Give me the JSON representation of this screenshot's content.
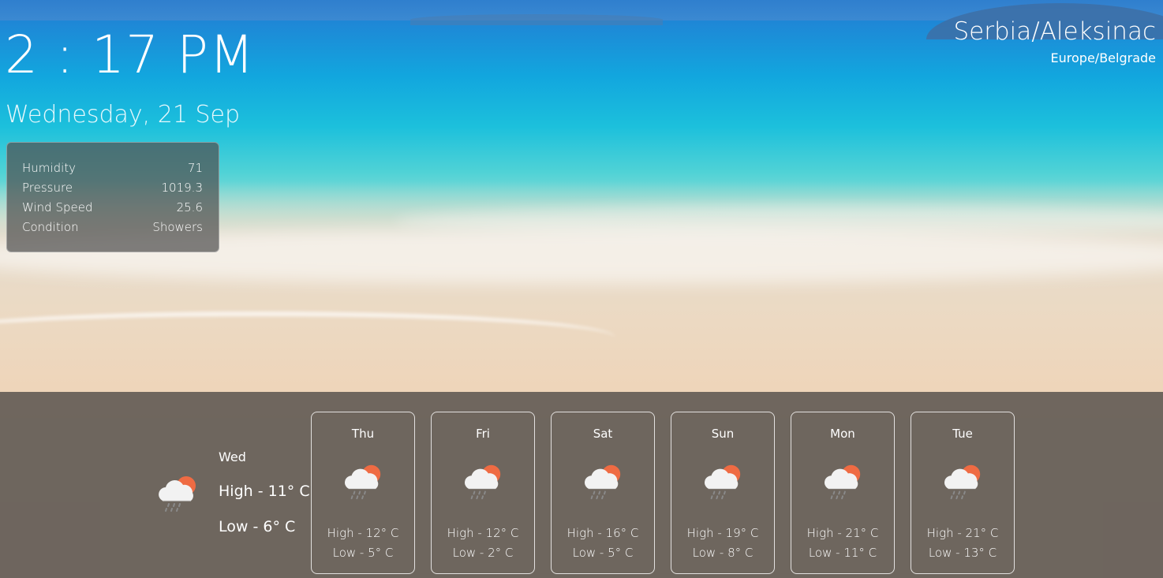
{
  "clock": {
    "time": "2 : 17 PM",
    "date": "Wednesday, 21 Sep"
  },
  "location": {
    "city": "Serbia/Aleksinac",
    "timezone": "Europe/Belgrade"
  },
  "stats": [
    {
      "label": "Humidity",
      "value": "71"
    },
    {
      "label": "Pressure",
      "value": "1019.3"
    },
    {
      "label": "Wind Speed",
      "value": "25.6"
    },
    {
      "label": "Condition",
      "value": "Showers"
    }
  ],
  "today": {
    "day": "Wed",
    "high": "High - 11° C",
    "low": "Low - 6° C",
    "icon": "rain-cloud-sun-icon"
  },
  "forecast": [
    {
      "day": "Thu",
      "high": "High - 12° C",
      "low": "Low - 5° C",
      "icon": "rain-cloud-sun-icon"
    },
    {
      "day": "Fri",
      "high": "High - 12° C",
      "low": "Low - 2° C",
      "icon": "rain-cloud-sun-icon"
    },
    {
      "day": "Sat",
      "high": "High - 16° C",
      "low": "Low - 5° C",
      "icon": "rain-cloud-sun-icon"
    },
    {
      "day": "Sun",
      "high": "High - 19° C",
      "low": "Low - 8° C",
      "icon": "rain-cloud-sun-icon"
    },
    {
      "day": "Mon",
      "high": "High - 21° C",
      "low": "Low - 11° C",
      "icon": "rain-cloud-sun-icon"
    },
    {
      "day": "Tue",
      "high": "High - 21° C",
      "low": "Low - 13° C",
      "icon": "rain-cloud-sun-icon"
    }
  ],
  "colors": {
    "sun": "#ef6b43",
    "cloud": "#f2f2f2",
    "rain": "#8a8a8a",
    "bar": "#645c56"
  }
}
